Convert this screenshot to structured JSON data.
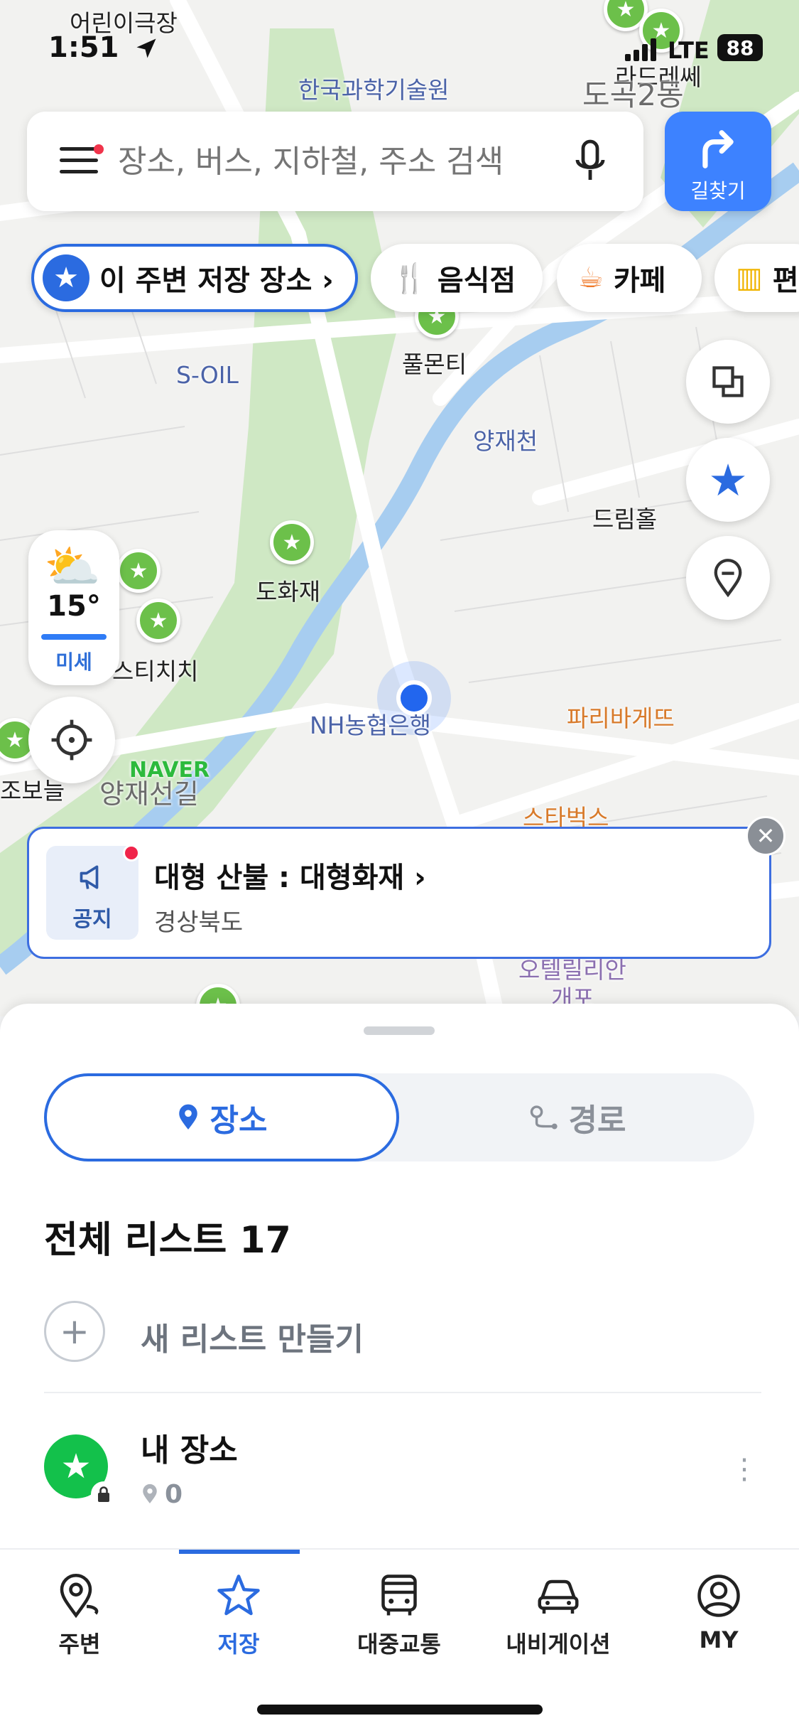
{
  "status": {
    "time": "1:51",
    "network": "LTE",
    "battery": "88"
  },
  "map": {
    "labels": {
      "theater": "어린이극장",
      "science": "한국과학기술원",
      "lardresse": "라드레쎄",
      "dogok": "도곡2동",
      "soil": "S-OIL",
      "pulmonti": "풀몬티",
      "yangjaecheon": "양재천",
      "dreamhall": "드림홀",
      "dohwajae": "도화재",
      "stichichi": "스티치치",
      "nh": "NH농협은행",
      "paris": "파리바게뜨",
      "naver": "NAVER",
      "yangjaeseongil": "양재선길",
      "starbucks": "스타벅스",
      "hotel": "오텔릴리안",
      "gaepo": "개포",
      "jobol": "조보늘"
    },
    "weather": {
      "temp": "15°",
      "dust": "미세"
    }
  },
  "search": {
    "placeholder": "장소, 버스, 지하철, 주소 검색",
    "route_label": "길찾기"
  },
  "chips": [
    {
      "label": "이 주변 저장 장소 ›",
      "icon": "star-icon"
    },
    {
      "label": "음식점",
      "icon": "fork-knife-icon"
    },
    {
      "label": "카페",
      "icon": "cup-icon"
    },
    {
      "label": "편",
      "icon": "store-icon"
    }
  ],
  "notice": {
    "badge": "공지",
    "title": "대형 산불 : 대형화재 ›",
    "subtitle": "경상북도"
  },
  "sheet": {
    "tabs": {
      "places": "장소",
      "routes": "경로"
    },
    "list_title": "전체 리스트 17",
    "new_list": "새 리스트 만들기",
    "items": [
      {
        "name": "내 장소",
        "count": "0"
      }
    ]
  },
  "tabbar": [
    {
      "label": "주변",
      "icon": "nearby-icon"
    },
    {
      "label": "저장",
      "icon": "star-icon",
      "active": true
    },
    {
      "label": "대중교통",
      "icon": "bus-icon"
    },
    {
      "label": "내비게이션",
      "icon": "car-icon"
    },
    {
      "label": "MY",
      "icon": "profile-icon"
    }
  ],
  "colors": {
    "accent": "#2b6be0",
    "route_button": "#3d82ff",
    "saved_pin": "#6cc04a",
    "notice_dot": "#f0244a"
  }
}
